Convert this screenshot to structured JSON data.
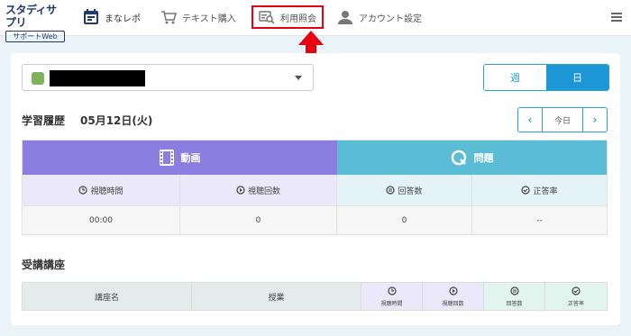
{
  "header": {
    "logo_top": "スタディサプリ",
    "logo_bottom": "サポートWeb",
    "nav": [
      {
        "label": "まなレポ",
        "icon": "calendar-icon"
      },
      {
        "label": "テキスト購入",
        "icon": "cart-icon"
      },
      {
        "label": "利用照会",
        "icon": "search-report-icon"
      },
      {
        "label": "アカウント設定",
        "icon": "user-icon"
      }
    ],
    "menu_icon": "hamburger-menu-icon"
  },
  "colors": {
    "primary": "#1d96d6",
    "video_band": "#8b7ee0",
    "quiz_band": "#5bbcd6",
    "highlight_box": "#e60012",
    "arrow": "#e60012"
  },
  "user_select": {
    "name": "■■■■■■■■■■"
  },
  "period_toggle": {
    "week": "週",
    "day": "日",
    "selected": "日"
  },
  "history": {
    "title": "学習履歴",
    "date": "05月12日(火)",
    "today_button": "今日",
    "prev": "‹",
    "next": "›"
  },
  "stats": {
    "video_label": "動画",
    "quiz_label": "問題",
    "headers": [
      "視聴時間",
      "視聴回数",
      "回答数",
      "正答率"
    ],
    "values": [
      "00:00",
      "0",
      "0",
      "--"
    ]
  },
  "courses": {
    "title": "受講講座",
    "headers": {
      "course_name": "講座名",
      "lesson": "授業",
      "watch_time": "視聴時間",
      "watch_count": "視聴回数",
      "answers": "回答数",
      "accuracy": "正答率"
    }
  }
}
